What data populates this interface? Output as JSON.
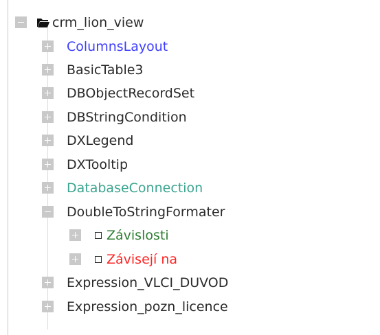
{
  "tree": {
    "root": {
      "label": "crm_lion_view",
      "icon": "folder-open-icon",
      "expanded": true
    },
    "items": [
      {
        "label": "ColumnsLayout",
        "color": "#3d3dff",
        "expanded": false
      },
      {
        "label": "BasicTable3",
        "color": "#2a2a2a",
        "expanded": false
      },
      {
        "label": "DBObjectRecordSet",
        "color": "#2a2a2a",
        "expanded": false
      },
      {
        "label": "DBStringCondition",
        "color": "#2a2a2a",
        "expanded": false
      },
      {
        "label": "DXLegend",
        "color": "#2a2a2a",
        "expanded": false
      },
      {
        "label": "DXTooltip",
        "color": "#2a2a2a",
        "expanded": false
      },
      {
        "label": "DatabaseConnection",
        "color": "#3aa58f",
        "expanded": false
      },
      {
        "label": "DoubleToStringFormater",
        "color": "#2a2a2a",
        "expanded": true,
        "children": [
          {
            "label": "Závislosti",
            "color": "#2e7d32",
            "icon": "square-node-icon",
            "expanded": false
          },
          {
            "label": "Závisejí na",
            "color": "#ff2222",
            "icon": "square-node-icon",
            "expanded": false
          }
        ]
      },
      {
        "label": "Expression_VLCI_DUVOD",
        "color": "#2a2a2a",
        "expanded": false
      },
      {
        "label": "Expression_pozn_licence",
        "color": "#2a2a2a",
        "expanded": false
      }
    ]
  }
}
